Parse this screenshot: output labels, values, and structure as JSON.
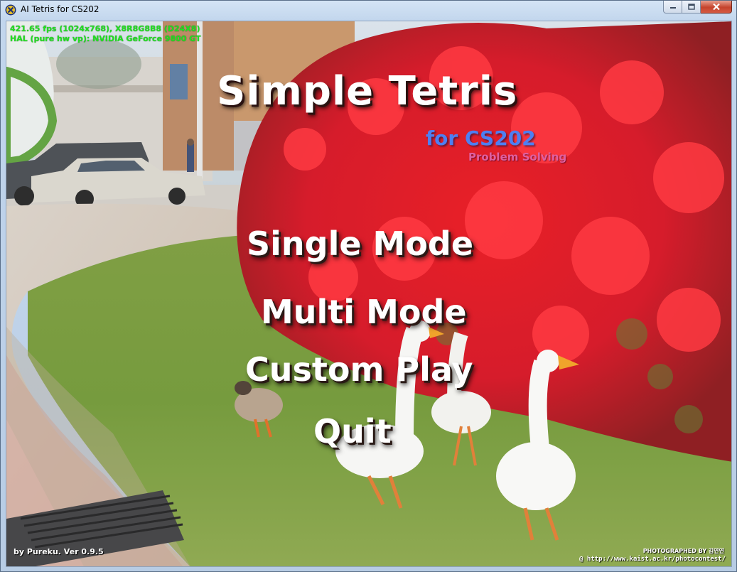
{
  "window": {
    "title": "AI Tetris for CS202",
    "controls": {
      "minimize": "minimize",
      "maximize": "maximize",
      "close": "close"
    }
  },
  "hud": {
    "line1": "421.65 fps (1024x768), X8R8G8B8 (D24X8)",
    "line2": "HAL (pure hw vp): NVIDIA GeForce 9800 GT"
  },
  "game": {
    "title": "Simple Tetris",
    "subtitle": "for CS202",
    "subtitle2": "Problem Solving"
  },
  "menu": {
    "items": [
      "Single Mode",
      "Multi Mode",
      "Custom Play",
      "Quit"
    ]
  },
  "footer": {
    "version": "by Pureku. Ver 0.9.5",
    "photo_credit": "PHOTOGRAPHED BY 김연연",
    "photo_url": "@ http://www.kaist.ac.kr/photocontest/"
  },
  "colors": {
    "hud_text": "#22e022",
    "subtitle": "#4e7ff2",
    "subtitle2": "#e060a0",
    "menu_text": "#ffffff"
  },
  "icons": {
    "app": "x-logo-icon",
    "minimize": "minimize-icon",
    "maximize": "maximize-icon",
    "close": "close-icon"
  }
}
